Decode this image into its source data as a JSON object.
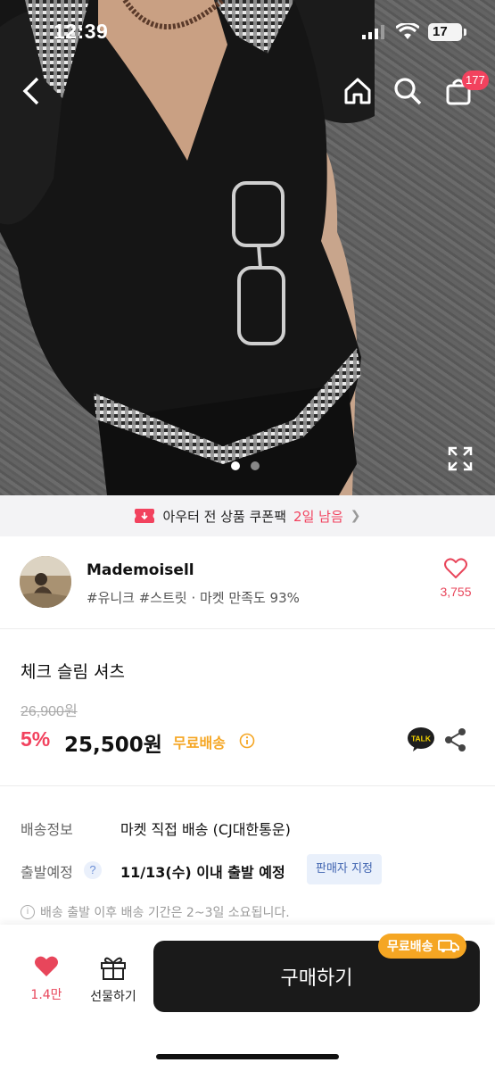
{
  "status_bar": {
    "time": "12:39",
    "battery": "17"
  },
  "nav": {
    "back_icon": "chevron-left-icon",
    "home_icon": "home-icon",
    "search_icon": "search-icon",
    "cart_icon": "shopping-bag-icon",
    "cart_badge": "177"
  },
  "gallery": {
    "total_images": 2,
    "active_index": 0
  },
  "coupon_banner": {
    "text": "아우터 전 상품 쿠폰팩",
    "days_left": "2일 남음"
  },
  "seller": {
    "name": "Mademoisell",
    "tags": "#유니크 #스트릿 · 마켓 만족도 93%",
    "likes": "3,755"
  },
  "product": {
    "title": "체크 슬림 셔츠",
    "original_price": "26,900원",
    "discount": "5%",
    "price": "25,500원",
    "free_shipping": "무료배송"
  },
  "delivery": {
    "info_label": "배송정보",
    "info_value": "마켓 직접 배송 (CJ대한통운)",
    "eta_label": "출발예정",
    "eta_value": "11/13(수) 이내 출발 예정",
    "seller_badge": "판매자 지정",
    "note": "배송 출발 이후 배송 기간은 2~3일 소요됩니다."
  },
  "bottom_bar": {
    "fav_count": "1.4만",
    "gift_label": "선물하기",
    "buy_label": "구매하기",
    "buy_badge": "무료배송"
  },
  "colors": {
    "accent": "#f2425e",
    "free_ship": "#f5a623",
    "buy_button": "#1a1a1a"
  }
}
